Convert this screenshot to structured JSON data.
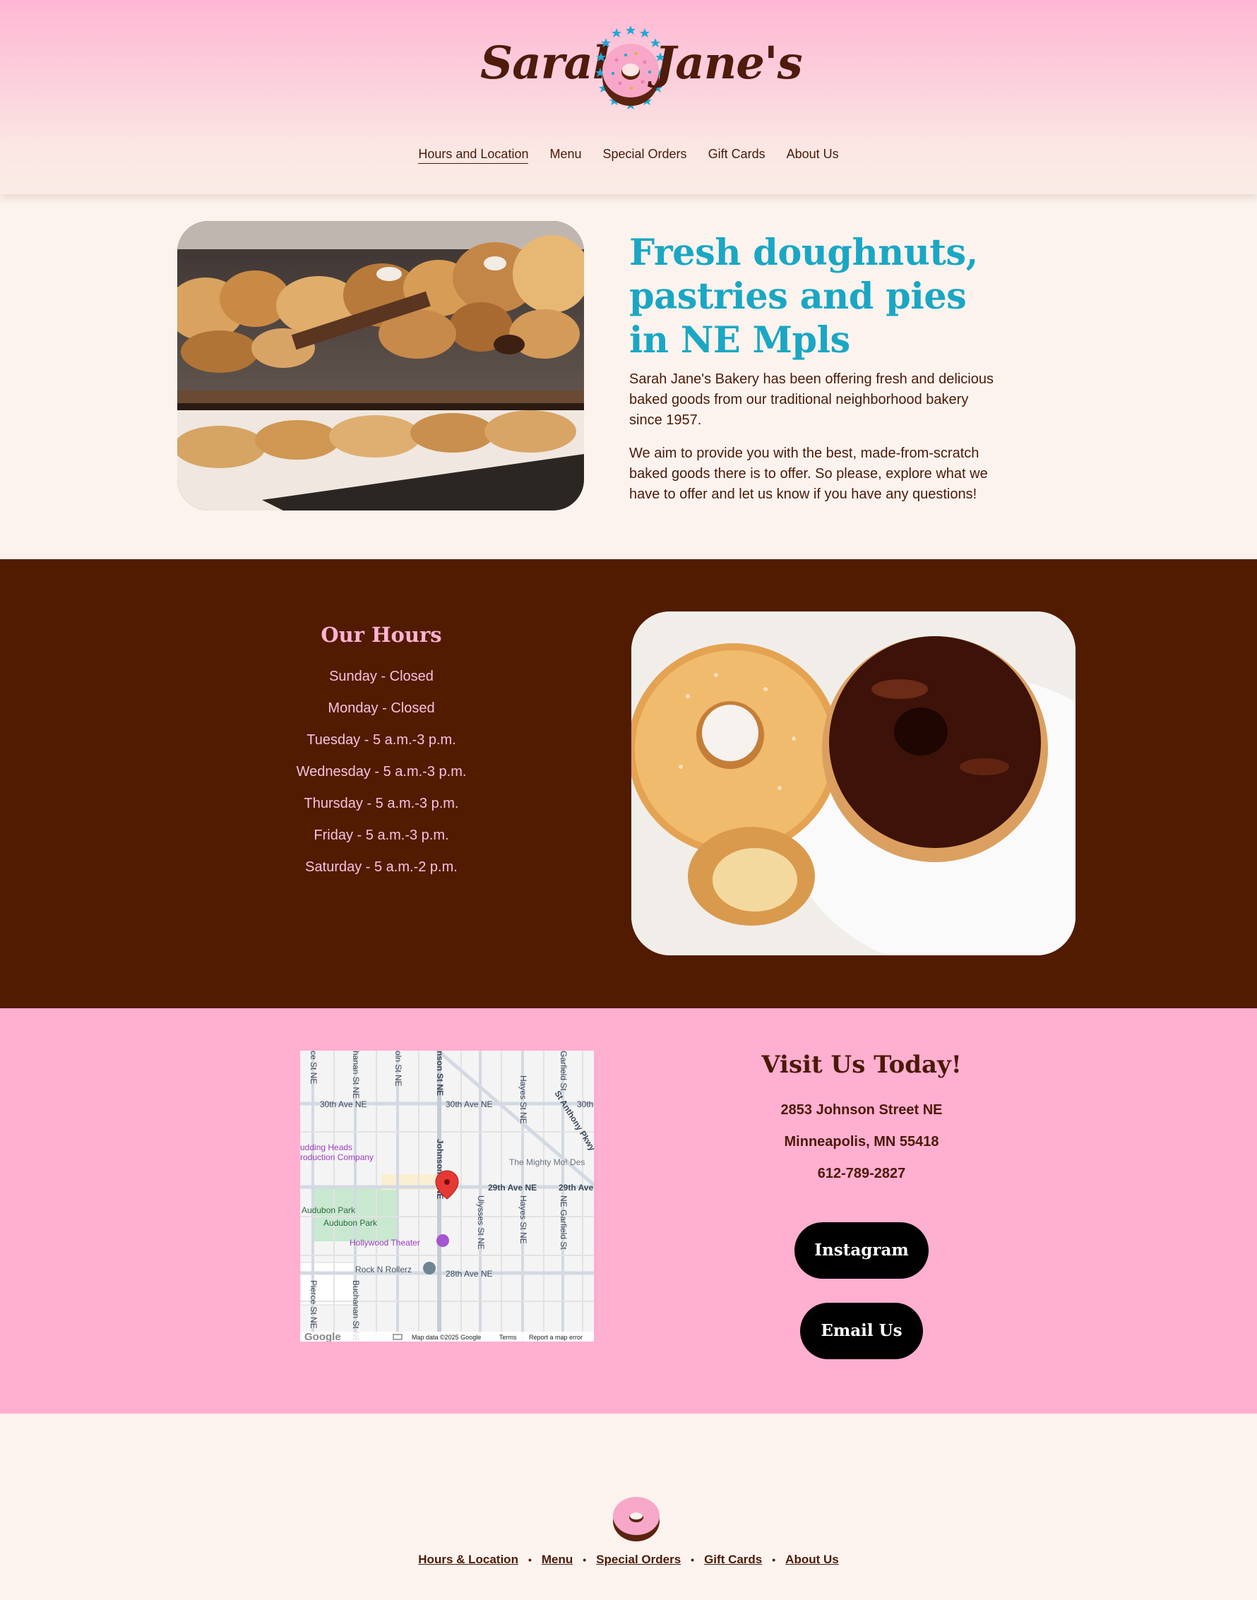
{
  "brand": {
    "logo_left": "Sarah",
    "logo_right": "Jane's"
  },
  "nav": [
    {
      "label": "Hours and Location"
    },
    {
      "label": "Menu"
    },
    {
      "label": "Special Orders"
    },
    {
      "label": "Gift Cards"
    },
    {
      "label": "About Us"
    }
  ],
  "intro": {
    "title": "Fresh doughnuts, pastries and pies in NE Mpls",
    "paragraphs": [
      "Sarah Jane's Bakery has been offering fresh and delicious baked goods from our traditional neighborhood bakery since 1957.",
      "We aim to provide you with the best, made-from-scratch baked goods there is to offer. So please, explore what we have to offer and let us know if you have any questions!"
    ]
  },
  "hours": {
    "title": "Our Hours",
    "lines": [
      "Sunday - Closed",
      "Monday - Closed",
      "Tuesday - 5 a.m.-3 p.m.",
      "Wednesday - 5 a.m.-3 p.m.",
      "Thursday - 5 a.m.-3 p.m.",
      "Friday - 5 a.m.-3 p.m.",
      "Saturday - 5 a.m.-2 p.m."
    ]
  },
  "map": {
    "labels": {
      "s30_w": "30th Ave NE",
      "s30_e": "30th Ave NE",
      "s30_far": "30th",
      "s29": "29th Ave NE",
      "s29_far": "29th Ave",
      "s28": "28th Ave NE",
      "stanthony": "St Anthony Pkwy",
      "johnson": "Johnson St NE",
      "johnson_top": "nson St NE",
      "hayes": "Hayes St NE",
      "hayes2": "Hayes St NE",
      "ulysses": "Ulysses St NE",
      "garfield": "NE Garfield St",
      "garfield_top": "Garfield St",
      "buchanan": "Buchanan St NE",
      "buchanan_top": "hanan St NE",
      "pierce": "Pierce St NE",
      "pierce_top": "ce St NE",
      "lincoln_top": "oln St NE",
      "pudding1": "udding Heads",
      "pudding2": "roduction Company",
      "mighty": "The Mighty Mo! Des",
      "audubon1": "Audubon Park",
      "audubon2": "Audubon Park",
      "hollywood": "Hollywood Theater",
      "rock": "Rock N Rollerz",
      "google": "Google",
      "mapdata": "Map data ©2025 Google",
      "terms": "Terms",
      "report": "Report a map error"
    }
  },
  "visit": {
    "title": "Visit Us Today!",
    "address1": "2853 Johnson Street NE",
    "address2": "Minneapolis, MN 55418",
    "phone": "612-789-2827",
    "instagram_label": "Instagram",
    "email_label": "Email Us"
  },
  "footer": {
    "links": [
      "Hours & Location",
      "Menu",
      "Special Orders",
      "Gift Cards",
      "About Us"
    ]
  },
  "colors": {
    "accent_teal": "#1aa7c4",
    "brown": "#511b00",
    "pink": "#ffafd0",
    "cream": "#fdf3ee"
  }
}
